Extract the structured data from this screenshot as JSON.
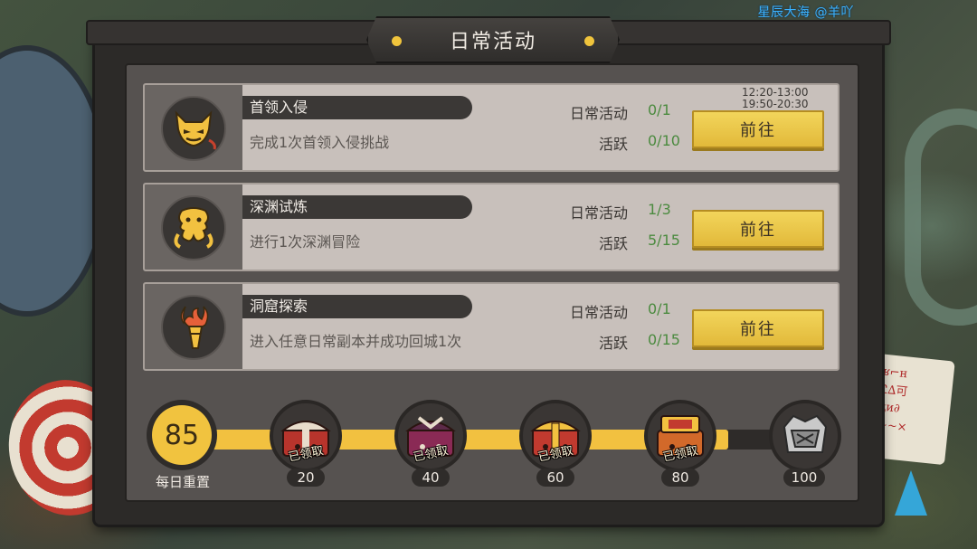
{
  "watermark": "星辰大海  @羊吖",
  "panel": {
    "title": "日常活动"
  },
  "labels": {
    "daily_activity": "日常活动",
    "active": "活跃",
    "go_button": "前往"
  },
  "tasks": [
    {
      "name": "首领入侵",
      "desc": "完成1次首领入侵挑战",
      "daily_value": "0/1",
      "active_value": "0/10",
      "time_1": "12:20-13:00",
      "time_2": "19:50-20:30",
      "icon": "demon-face-icon"
    },
    {
      "name": "深渊试炼",
      "desc": "进行1次深渊冒险",
      "daily_value": "1/3",
      "active_value": "5/15",
      "time_1": "",
      "time_2": "",
      "icon": "tentacle-monster-icon"
    },
    {
      "name": "洞窟探索",
      "desc": "进入任意日常副本并成功回城1次",
      "daily_value": "0/1",
      "active_value": "0/15",
      "time_1": "",
      "time_2": "",
      "icon": "torch-icon"
    }
  ],
  "progress": {
    "score": "85",
    "score_value": 85,
    "max_value": 100,
    "reset_label": "每日重置",
    "claimed_label": "已领取",
    "milestones": [
      {
        "value": "20",
        "claimed": true,
        "icon": "red-chest-icon"
      },
      {
        "value": "40",
        "claimed": true,
        "icon": "purple-chest-icon"
      },
      {
        "value": "60",
        "claimed": true,
        "icon": "gold-chest-icon"
      },
      {
        "value": "80",
        "claimed": true,
        "icon": "orange-chest-icon"
      },
      {
        "value": "100",
        "claimed": false,
        "icon": "silver-chest-icon"
      }
    ]
  },
  "colors": {
    "accent_yellow": "#f2c140",
    "progress_green": "#4b8a3f",
    "panel_dark": "#2c2a28",
    "row_light": "#c8c0bb"
  }
}
